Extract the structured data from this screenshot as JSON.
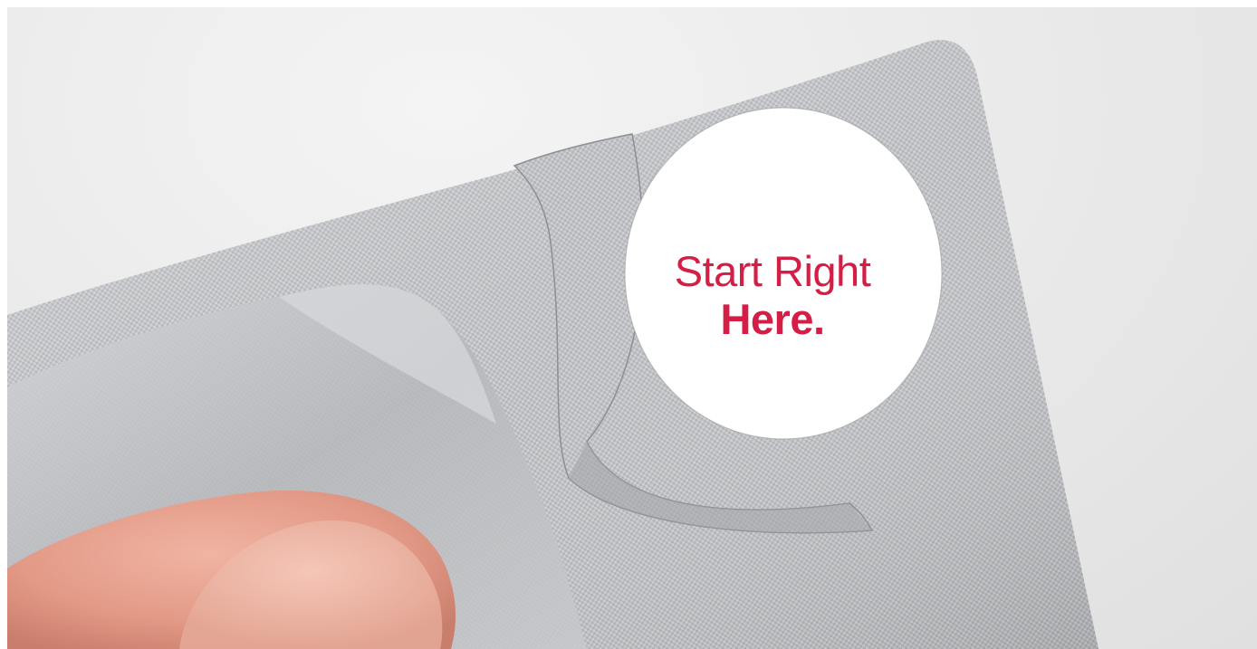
{
  "image": {
    "subject": "blister-pack-foil-with-punched-out-circle",
    "background_color": "#e9e9e9",
    "foil_color": "#b9bbbe",
    "skin_color": "#e8a391",
    "text_color": "#d41e45"
  },
  "headline": {
    "line1": "Start Right",
    "line2": "Here."
  }
}
